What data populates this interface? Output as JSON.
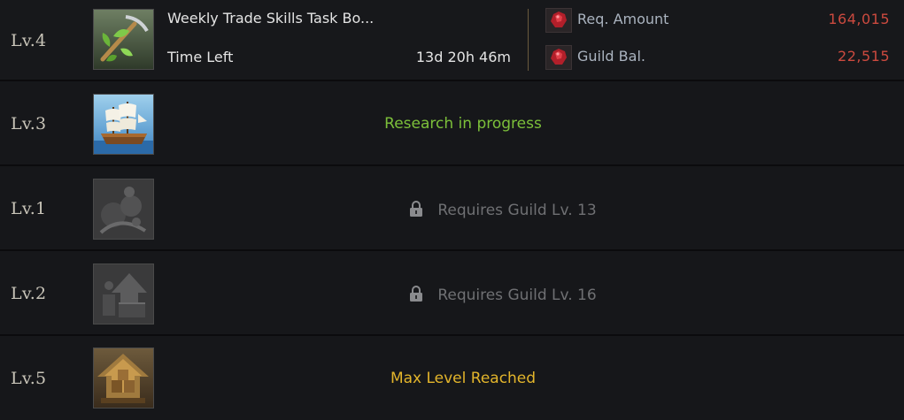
{
  "rows": [
    {
      "level": "Lv.4",
      "icon": "trade-skills-task-icon",
      "title": "Weekly Trade Skills Task Bo...",
      "time_label": "Time Left",
      "time_value": "13d 20h 46m",
      "req_label": "Req. Amount",
      "req_value": "164,015",
      "bal_label": "Guild Bal.",
      "bal_value": "22,515",
      "resource_icon": "bloodstone-icon"
    },
    {
      "level": "Lv.3",
      "icon": "ship-icon",
      "status": "Research in progress"
    },
    {
      "level": "Lv.1",
      "icon": "locked-research-icon",
      "status": "Requires Guild Lv. 13"
    },
    {
      "level": "Lv.2",
      "icon": "locked-upgrade-icon",
      "status": "Requires Guild Lv. 16"
    },
    {
      "level": "Lv.5",
      "icon": "storage-upgrade-icon",
      "status": "Max Level Reached"
    }
  ],
  "colors": {
    "progress": "#7cc03a",
    "locked": "#6f7073",
    "max": "#e3b52b",
    "negative": "#cc4a3f"
  }
}
